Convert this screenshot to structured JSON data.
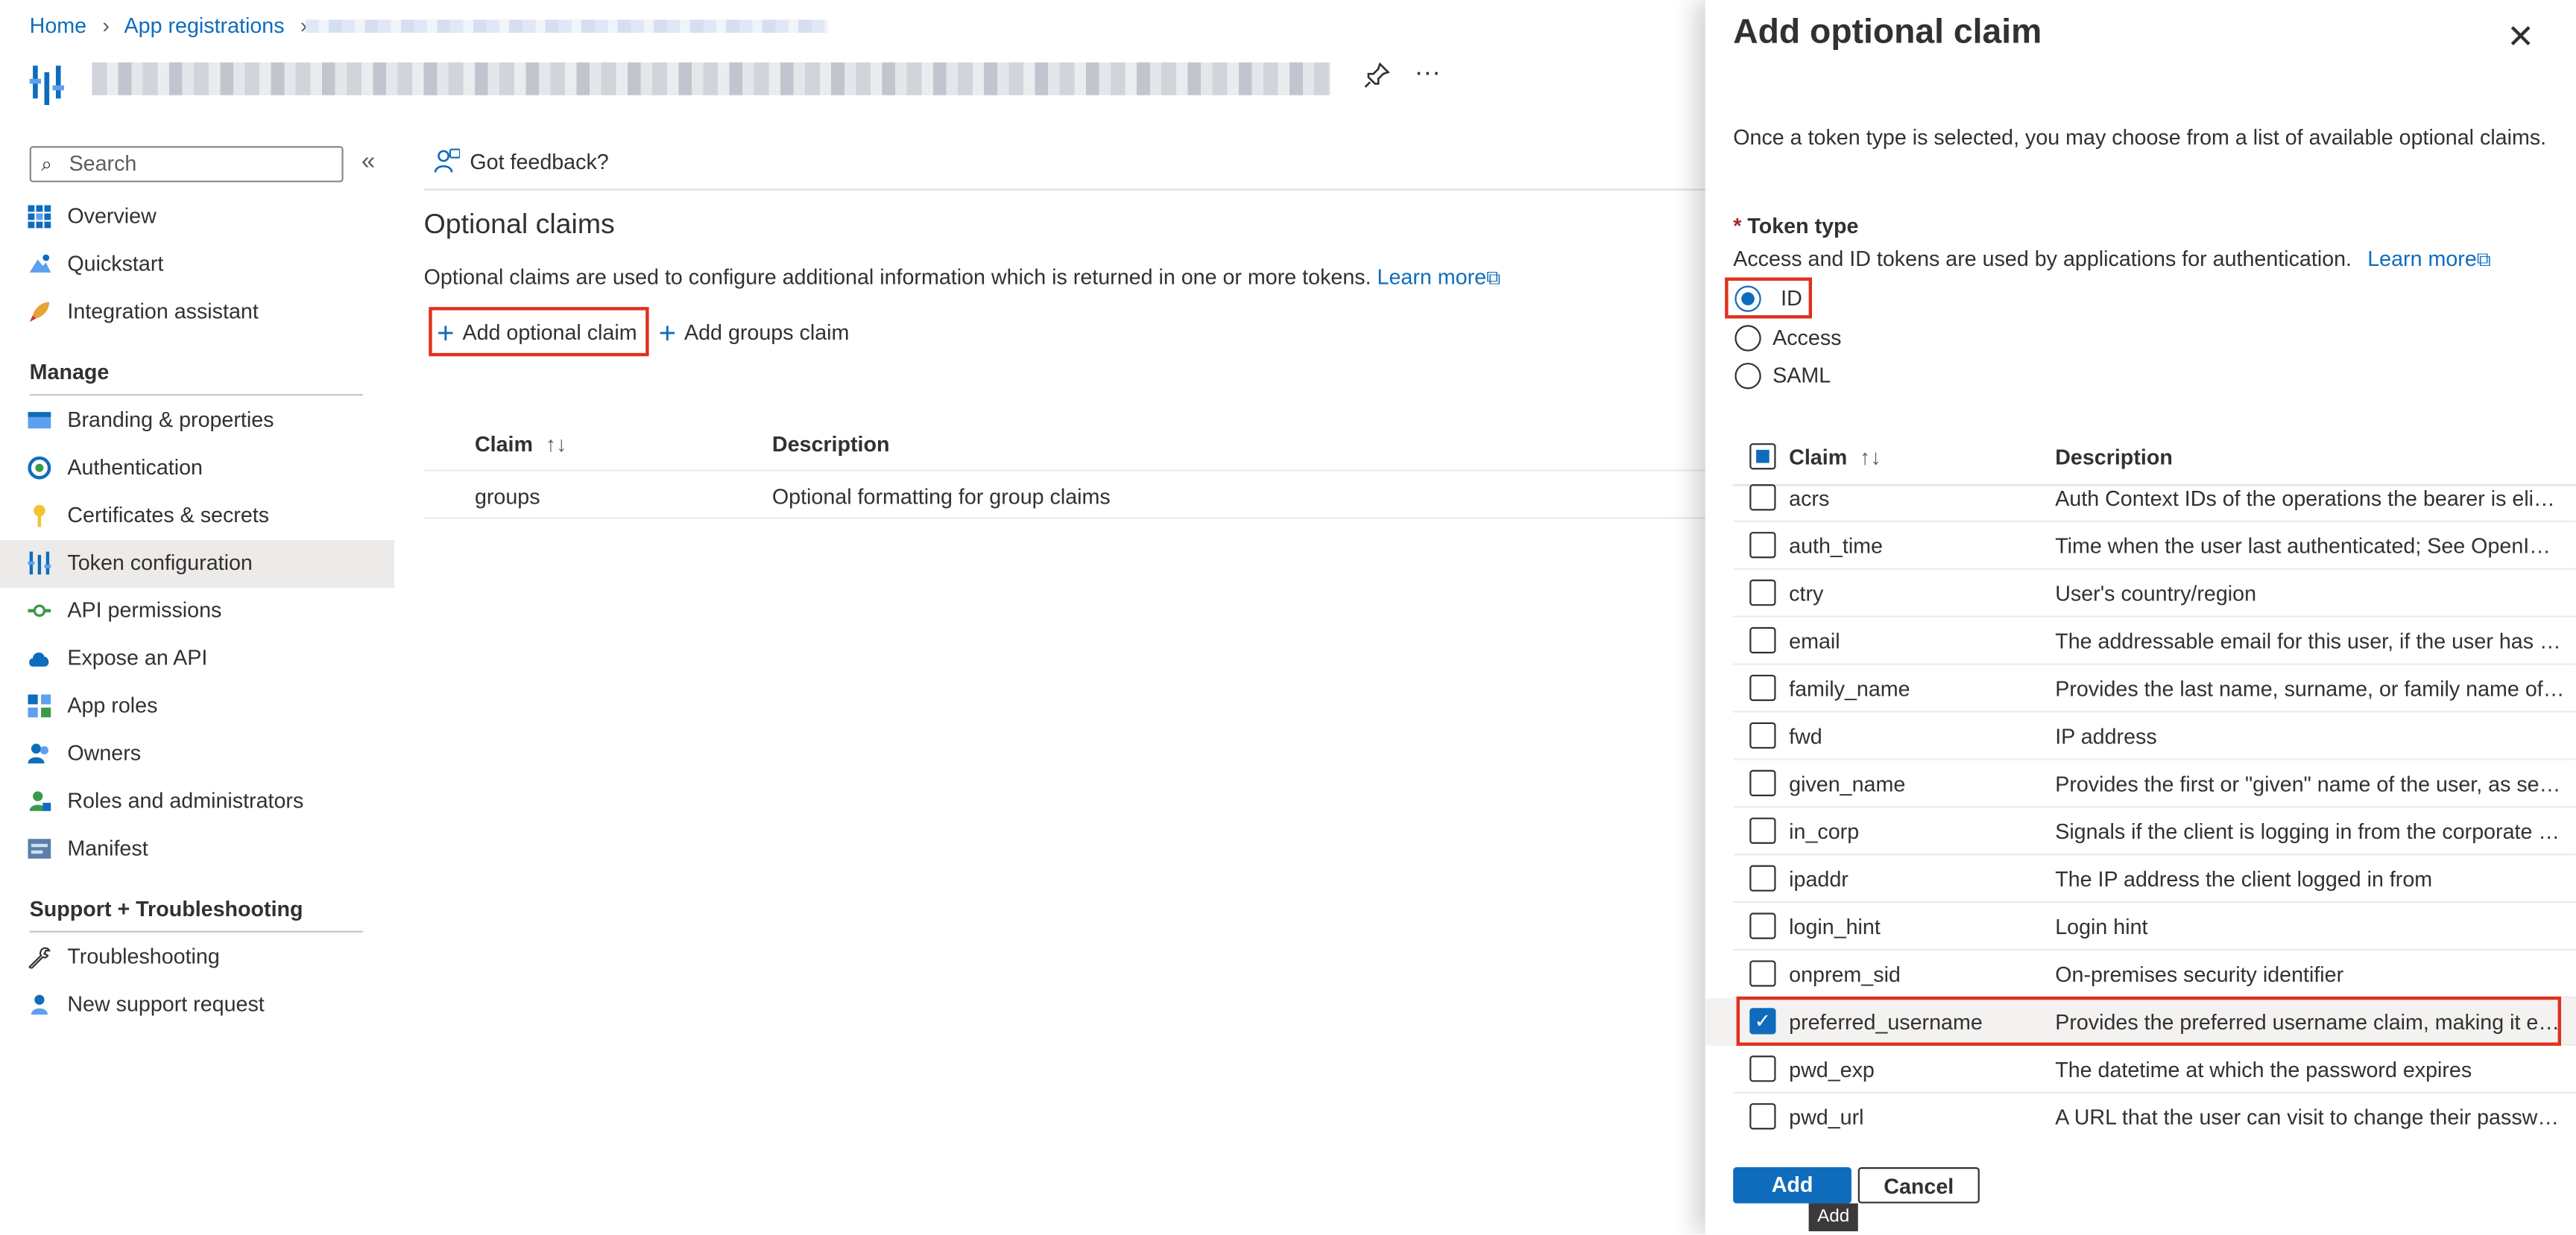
{
  "breadcrumb": {
    "home": "Home",
    "app_registrations": "App registrations"
  },
  "sidebar": {
    "search_placeholder": "Search",
    "collapse": "«",
    "top_items": [
      {
        "label": "Overview",
        "icon": "overview-icon"
      },
      {
        "label": "Quickstart",
        "icon": "quickstart-icon"
      },
      {
        "label": "Integration assistant",
        "icon": "rocket-icon"
      }
    ],
    "manage_heading": "Manage",
    "manage_items": [
      {
        "label": "Branding & properties",
        "icon": "branding-icon"
      },
      {
        "label": "Authentication",
        "icon": "authentication-icon"
      },
      {
        "label": "Certificates & secrets",
        "icon": "key-icon"
      },
      {
        "label": "Token configuration",
        "icon": "token-icon",
        "active": true
      },
      {
        "label": "API permissions",
        "icon": "api-permissions-icon"
      },
      {
        "label": "Expose an API",
        "icon": "cloud-icon"
      },
      {
        "label": "App roles",
        "icon": "app-roles-icon"
      },
      {
        "label": "Owners",
        "icon": "owners-icon"
      },
      {
        "label": "Roles and administrators",
        "icon": "roles-icon"
      },
      {
        "label": "Manifest",
        "icon": "manifest-icon"
      }
    ],
    "support_heading": "Support + Troubleshooting",
    "support_items": [
      {
        "label": "Troubleshooting",
        "icon": "wrench-icon"
      },
      {
        "label": "New support request",
        "icon": "support-icon"
      }
    ]
  },
  "main": {
    "feedback": "Got feedback?",
    "title": "Optional claims",
    "description": "Optional claims are used to configure additional information which is returned in one or more tokens.",
    "learn_more": "Learn more",
    "add_optional_claim": "Add optional claim",
    "add_groups_claim": "Add groups claim",
    "table": {
      "headers": [
        "Claim",
        "Description"
      ],
      "rows": [
        {
          "claim": "groups",
          "description": "Optional formatting for group claims"
        }
      ]
    }
  },
  "panel": {
    "title": "Add optional claim",
    "intro": "Once a token type is selected, you may choose from a list of available optional claims.",
    "required_mark": "*",
    "token_type_label": "Token type",
    "token_type_desc": "Access and ID tokens are used by applications for authentication.",
    "learn_more": "Learn more",
    "token_types": [
      {
        "label": "ID",
        "selected": true
      },
      {
        "label": "Access",
        "selected": false
      },
      {
        "label": "SAML",
        "selected": false
      }
    ],
    "table_headers": {
      "claim": "Claim",
      "description": "Description"
    },
    "claims": [
      {
        "name": "acrs",
        "description": "Auth Context IDs of the operations the bearer is eligible to perform",
        "checked": false
      },
      {
        "name": "auth_time",
        "description": "Time when the user last authenticated; See OpenID Connect spec",
        "checked": false
      },
      {
        "name": "ctry",
        "description": "User's country/region",
        "checked": false
      },
      {
        "name": "email",
        "description": "The addressable email for this user, if the user has one",
        "checked": false
      },
      {
        "name": "family_name",
        "description": "Provides the last name, surname, or family name of the user",
        "checked": false
      },
      {
        "name": "fwd",
        "description": "IP address",
        "checked": false
      },
      {
        "name": "given_name",
        "description": "Provides the first or \"given\" name of the user, as set on the user object",
        "checked": false
      },
      {
        "name": "in_corp",
        "description": "Signals if the client is logging in from the corporate network",
        "checked": false
      },
      {
        "name": "ipaddr",
        "description": "The IP address the client logged in from",
        "checked": false
      },
      {
        "name": "login_hint",
        "description": "Login hint",
        "checked": false
      },
      {
        "name": "onprem_sid",
        "description": "On-premises security identifier",
        "checked": false
      },
      {
        "name": "preferred_username",
        "description": "Provides the preferred username claim, making it easier for apps",
        "checked": true
      },
      {
        "name": "pwd_exp",
        "description": "The datetime at which the password expires",
        "checked": false
      },
      {
        "name": "pwd_url",
        "description": "A URL that the user can visit to change their password",
        "checked": false
      }
    ],
    "add_button": "Add",
    "cancel_button": "Cancel",
    "tooltip": "Add"
  },
  "colors": {
    "accent": "#0f6cbd",
    "highlight": "#e0301e"
  }
}
